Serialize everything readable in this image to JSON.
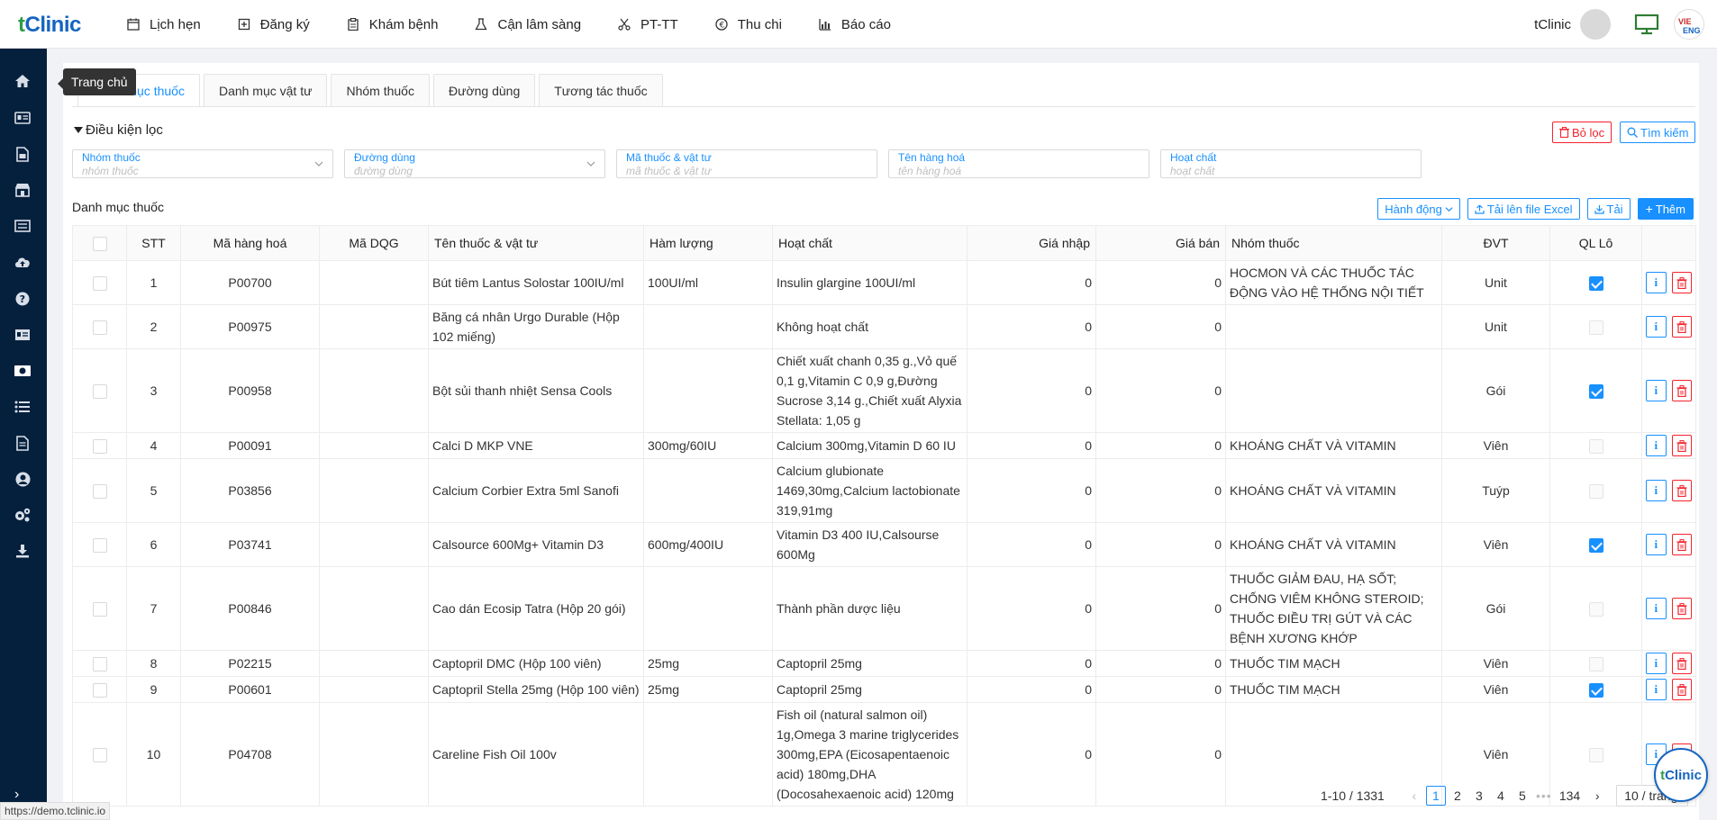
{
  "app": {
    "logo_t": "t",
    "logo_rest": "Clinic"
  },
  "nav": [
    {
      "label": "Lịch hẹn",
      "icon": "calendar-icon"
    },
    {
      "label": "Đăng ký",
      "icon": "register-icon"
    },
    {
      "label": "Khám bệnh",
      "icon": "clipboard-icon"
    },
    {
      "label": "Cận lâm sàng",
      "icon": "flask-icon"
    },
    {
      "label": "PT-TT",
      "icon": "scissors-icon"
    },
    {
      "label": "Thu chi",
      "icon": "coin-icon"
    },
    {
      "label": "Báo cáo",
      "icon": "chart-icon"
    }
  ],
  "user": {
    "name": "tClinic",
    "lang_vi": "VIE",
    "lang_en": "ENG"
  },
  "sidebar": {
    "tooltip": "Trang chủ",
    "icons": [
      "home-icon",
      "id-card-icon",
      "document-icon",
      "store-icon",
      "list-icon",
      "cloud-upload-icon",
      "help-icon",
      "card-icon",
      "cash-icon",
      "menu-list-icon",
      "file-icon",
      "user-circle-icon",
      "settings-icon",
      "download-icon"
    ]
  },
  "tabs": [
    "Danh mục thuốc",
    "Danh mục vật tư",
    "Nhóm thuốc",
    "Đường dùng",
    "Tương tác thuốc"
  ],
  "filter": {
    "title": "Điều kiện lọc",
    "clear_label": "Bỏ lọc",
    "search_label": "Tìm kiếm",
    "fields": [
      {
        "label": "Nhóm thuốc",
        "placeholder": "nhóm thuốc",
        "select": true
      },
      {
        "label": "Đường dùng",
        "placeholder": "đường dùng",
        "select": true
      },
      {
        "label": "Mã thuốc & vật tư",
        "placeholder": "mã thuốc & vật tư",
        "select": false
      },
      {
        "label": "Tên hàng hoá",
        "placeholder": "tên hàng hoá",
        "select": false
      },
      {
        "label": "Hoạt chất",
        "placeholder": "hoạt chất",
        "select": false
      }
    ]
  },
  "list": {
    "title": "Danh mục thuốc",
    "action_label": "Hành động",
    "upload_label": "Tải lên file Excel",
    "download_label": "Tải",
    "add_label": "Thêm"
  },
  "table": {
    "headers": [
      "STT",
      "Mã hàng hoá",
      "Mã DQG",
      "Tên thuốc & vật tư",
      "Hàm lượng",
      "Hoạt chất",
      "Giá nhập",
      "Giá bán",
      "Nhóm thuốc",
      "ĐVT",
      "QL Lô"
    ],
    "rows": [
      {
        "stt": "1",
        "code": "P00700",
        "dqg": "",
        "name": "Bút tiêm Lantus Solostar 100IU/ml",
        "strength": "100UI/ml",
        "ingredient": "Insulin glargine 100UI/ml",
        "buy": "0",
        "sell": "0",
        "group": "HOCMON VÀ CÁC THUỐC TÁC ĐỘNG VÀO HỆ THỐNG NỘI TIẾT",
        "unit": "Unit",
        "lot": true
      },
      {
        "stt": "2",
        "code": "P00975",
        "dqg": "",
        "name": "Băng cá nhân Urgo Durable (Hộp 102 miếng)",
        "strength": "",
        "ingredient": "Không hoạt chất",
        "buy": "0",
        "sell": "0",
        "group": "",
        "unit": "Unit",
        "lot": false
      },
      {
        "stt": "3",
        "code": "P00958",
        "dqg": "",
        "name": "Bột sủi thanh nhiệt Sensa Cools",
        "strength": "",
        "ingredient": "Chiết xuất chanh 0,35 g.,Vỏ quế 0,1 g,Vitamin C 0,9 g,Đường Sucrose 3,14 g.,Chiết xuất Alyxia Stellata: 1,05 g",
        "buy": "0",
        "sell": "0",
        "group": "",
        "unit": "Gói",
        "lot": true
      },
      {
        "stt": "4",
        "code": "P00091",
        "dqg": "",
        "name": "Calci D MKP VNE",
        "strength": "300mg/60IU",
        "ingredient": "Calcium 300mg,Vitamin D 60 IU",
        "buy": "0",
        "sell": "0",
        "group": "KHOÁNG CHẤT VÀ VITAMIN",
        "unit": "Viên",
        "lot": false
      },
      {
        "stt": "5",
        "code": "P03856",
        "dqg": "",
        "name": "Calcium Corbier Extra 5ml Sanofi",
        "strength": "",
        "ingredient": "Calcium glubionate 1469,30mg,Calcium lactobionate 319,91mg",
        "buy": "0",
        "sell": "0",
        "group": "KHOÁNG CHẤT VÀ VITAMIN",
        "unit": "Tuýp",
        "lot": false
      },
      {
        "stt": "6",
        "code": "P03741",
        "dqg": "",
        "name": "Calsource 600Mg+ Vitamin D3",
        "strength": "600mg/400IU",
        "ingredient": "Vitamin D3 400 IU,Calsourse 600Mg",
        "buy": "0",
        "sell": "0",
        "group": "KHOÁNG CHẤT VÀ VITAMIN",
        "unit": "Viên",
        "lot": true
      },
      {
        "stt": "7",
        "code": "P00846",
        "dqg": "",
        "name": "Cao dán Ecosip Tatra (Hộp 20 gói)",
        "strength": "",
        "ingredient": "Thành phần dược liệu",
        "buy": "0",
        "sell": "0",
        "group": "THUỐC GIẢM ĐAU, HẠ SỐT; CHỐNG VIÊM KHÔNG STEROID; THUỐC ĐIỀU TRỊ GÚT VÀ CÁC BỆNH XƯƠNG KHỚP",
        "unit": "Gói",
        "lot": false
      },
      {
        "stt": "8",
        "code": "P02215",
        "dqg": "",
        "name": "Captopril DMC (Hộp 100 viên)",
        "strength": "25mg",
        "ingredient": "Captopril 25mg",
        "buy": "0",
        "sell": "0",
        "group": "THUỐC TIM MẠCH",
        "unit": "Viên",
        "lot": false
      },
      {
        "stt": "9",
        "code": "P00601",
        "dqg": "",
        "name": "Captopril Stella 25mg (Hộp 100 viên)",
        "strength": "25mg",
        "ingredient": "Captopril 25mg",
        "buy": "0",
        "sell": "0",
        "group": "THUỐC TIM MẠCH",
        "unit": "Viên",
        "lot": true
      },
      {
        "stt": "10",
        "code": "P04708",
        "dqg": "",
        "name": "Careline Fish Oil 100v",
        "strength": "",
        "ingredient": "Fish oil (natural salmon oil) 1g,Omega 3 marine triglycerides 300mg,EPA (Eicosapentaenoic acid) 180mg,DHA (Docosahexaenoic acid) 120mg",
        "buy": "0",
        "sell": "0",
        "group": "",
        "unit": "Viên",
        "lot": false
      }
    ]
  },
  "pagination": {
    "total": "1-10 / 1331",
    "pages": [
      "1",
      "2",
      "3",
      "4",
      "5"
    ],
    "current": "1",
    "dots": "•••",
    "last": "134",
    "size": "10 / trang"
  },
  "fab": {
    "t": "t",
    "rest": "Clinic"
  },
  "status_url": "https://demo.tclinic.io",
  "colors": {
    "primary": "#1890ff",
    "danger": "#f5222d",
    "sidebar": "#05203d",
    "brand": "#1565c0",
    "brand_t": "#2e9c4a"
  }
}
